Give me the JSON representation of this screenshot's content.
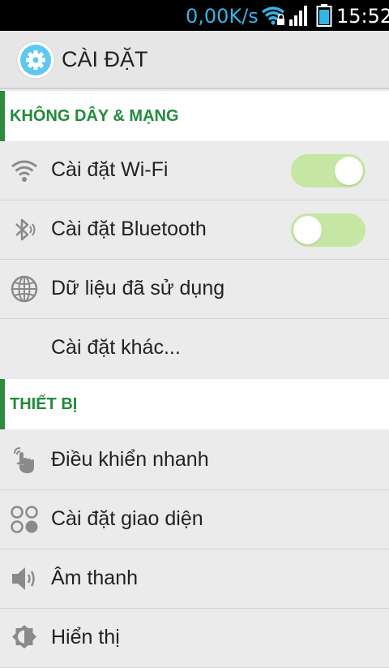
{
  "status_bar": {
    "network_speed": "0,00K/s",
    "time": "15:52",
    "wifi_icon": "wifi-lock-icon",
    "signal_icon": "signal-icon",
    "battery_icon": "battery-icon"
  },
  "action_bar": {
    "title": "CÀI ĐẶT",
    "icon": "settings-gear-icon"
  },
  "sections": [
    {
      "title": "KHÔNG DÂY & MẠNG",
      "items": [
        {
          "label": "Cài đặt Wi-Fi",
          "icon": "wifi-icon",
          "toggle": true
        },
        {
          "label": "Cài đặt Bluetooth",
          "icon": "bluetooth-icon",
          "toggle": false
        },
        {
          "label": "Dữ liệu đã sử dụng",
          "icon": "globe-icon"
        },
        {
          "label": "Cài đặt khác..."
        }
      ]
    },
    {
      "title": "THIẾT BỊ",
      "items": [
        {
          "label": "Điều khiển nhanh",
          "icon": "touch-hand-icon"
        },
        {
          "label": "Cài đặt giao diện",
          "icon": "theme-circles-icon"
        },
        {
          "label": "Âm thanh",
          "icon": "speaker-icon"
        },
        {
          "label": "Hiển thị",
          "icon": "brightness-icon"
        }
      ]
    }
  ],
  "colors": {
    "accent_green": "#218a3a",
    "toggle_track": "#c6e6a3",
    "status_text_blue": "#33b5e5",
    "app_icon_blue": "#5ec8ef"
  }
}
